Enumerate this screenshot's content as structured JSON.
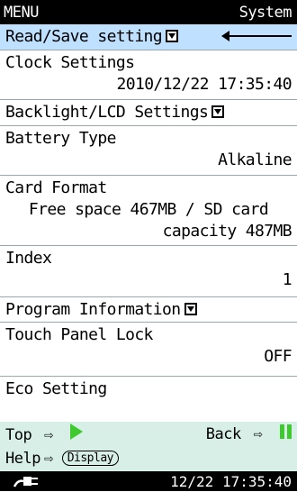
{
  "header": {
    "left": "MENU",
    "right": "System"
  },
  "menu": {
    "read_save": "Read/Save setting",
    "clock_title": "Clock Settings",
    "clock_value": "2010/12/22 17:35:40",
    "backlight": "Backlight/LCD Settings",
    "battery_title": "Battery Type",
    "battery_value": "Alkaline",
    "card_title": "Card Format",
    "card_value_line1": "Free space 467MB / SD card",
    "card_value_line2": "capacity 487MB",
    "index_title": "Index",
    "index_value": "1",
    "program_info": "Program Information",
    "touch_title": "Touch Panel Lock",
    "touch_value": "OFF",
    "eco_title": "Eco Setting"
  },
  "help": {
    "top_label": "Top",
    "back_label": "Back",
    "help_label": "Help",
    "display_button": "Display",
    "arrow": "⇨"
  },
  "status": {
    "datetime": "12/22 17:35:40"
  },
  "colors": {
    "selected_bg": "#bfe0ff",
    "help_bg": "#d8efe8",
    "accent_green": "#3ec92e"
  }
}
